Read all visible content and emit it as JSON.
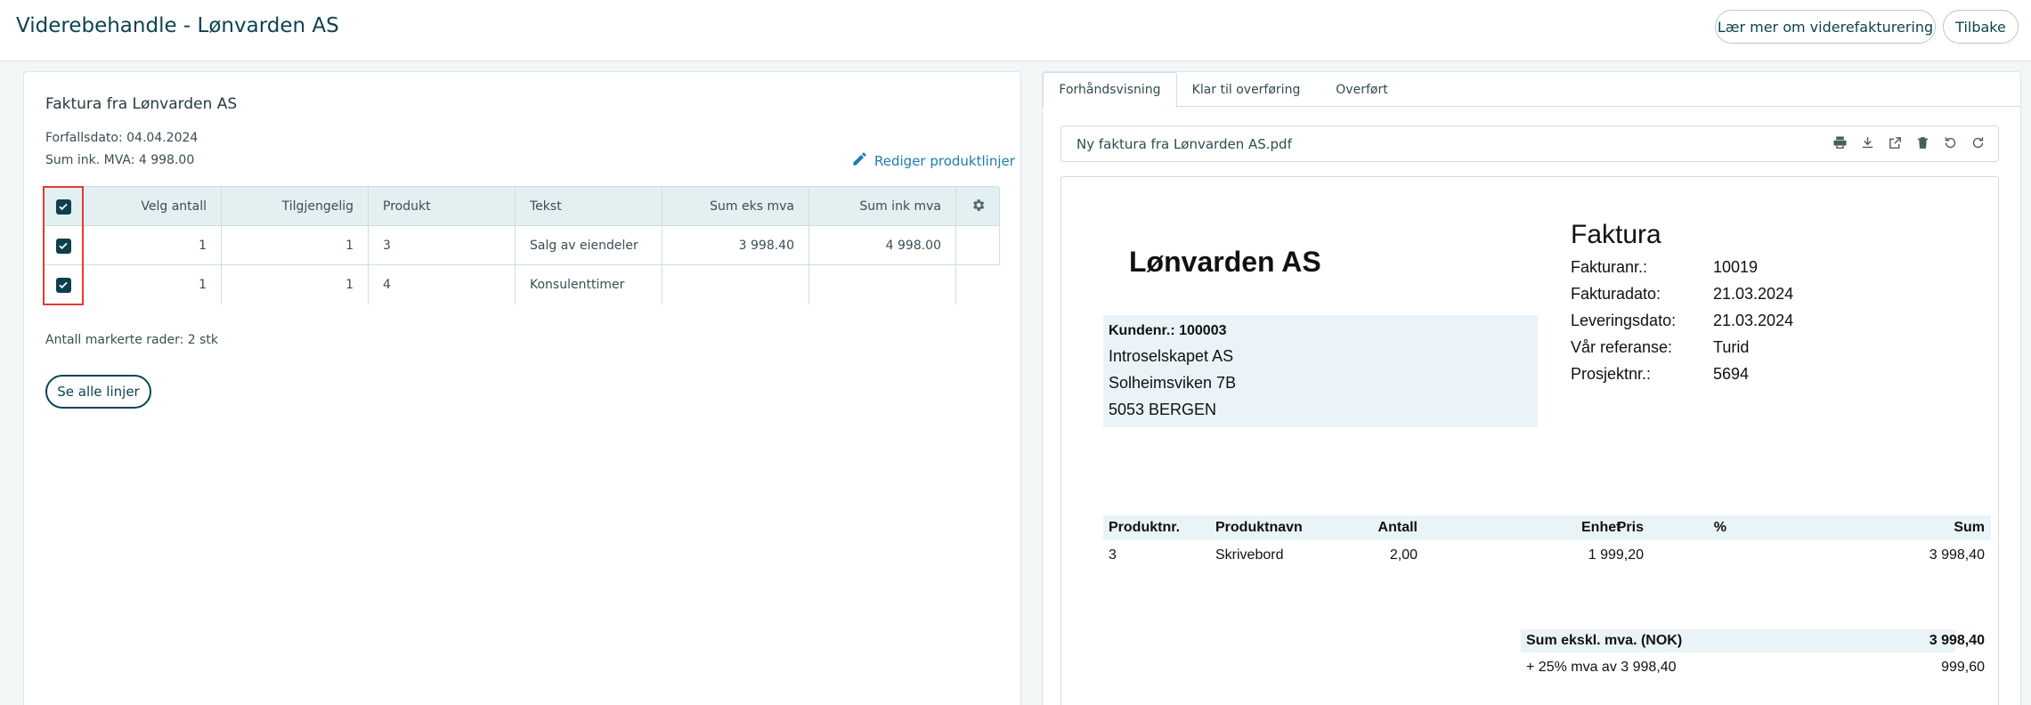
{
  "header": {
    "title": "Viderebehandle - Lønvarden AS",
    "learn_more_label": "Lær mer om viderefakturering",
    "back_label": "Tilbake"
  },
  "left": {
    "invoice_title": "Faktura fra Lønvarden AS",
    "due_date": "Forfallsdato: 04.04.2024",
    "sum_inc_vat": "Sum ink. MVA: 4 998.00",
    "edit_lines_label": "Rediger produktlinjer",
    "table": {
      "columns": [
        "Velg antall",
        "Tilgjengelig",
        "Produkt",
        "Tekst",
        "Sum eks mva",
        "Sum ink mva"
      ],
      "rows": [
        {
          "checked": true,
          "velg_antall": "1",
          "tilgjengelig": "1",
          "produkt": "3",
          "tekst": "Salg av eiendeler",
          "sum_eks": "3 998.40",
          "sum_ink": "4 998.00"
        },
        {
          "checked": true,
          "velg_antall": "1",
          "tilgjengelig": "1",
          "produkt": "4",
          "tekst": "Konsulenttimer",
          "sum_eks": "",
          "sum_ink": ""
        }
      ]
    },
    "selected_count": "Antall markerte rader: 2 stk",
    "see_all_label": "Se alle linjer"
  },
  "right": {
    "tabs": [
      {
        "label": "Forhåndsvisning",
        "active": true
      },
      {
        "label": "Klar til overføring",
        "active": false
      },
      {
        "label": "Overført",
        "active": false
      }
    ],
    "file_name": "Ny faktura fra Lønvarden AS.pdf",
    "file_icons": [
      "print-icon",
      "download-icon",
      "open-external-icon",
      "delete-icon",
      "rotate-left-icon",
      "rotate-right-icon"
    ],
    "pdf": {
      "company": "Lønvarden AS",
      "doc_title": "Faktura",
      "meta": [
        {
          "label": "Fakturanr.:",
          "value": "10019"
        },
        {
          "label": "Fakturadato:",
          "value": "21.03.2024"
        },
        {
          "label": "Leveringsdato:",
          "value": "21.03.2024"
        },
        {
          "label": "Vår referanse:",
          "value": "Turid"
        },
        {
          "label": "Prosjektnr.:",
          "value": "5694"
        }
      ],
      "customer_no": "Kundenr.: 100003",
      "customer_name": "Introselskapet AS",
      "customer_street": "Solheimsviken 7B",
      "customer_city": "5053  BERGEN",
      "lines_header": {
        "produktnr": "Produktnr.",
        "produktnavn": "Produktnavn",
        "antall": "Antall",
        "enhet": "Enhet",
        "pris": "Pris",
        "pct": "%",
        "sum": "Sum"
      },
      "lines": [
        {
          "produktnr": "3",
          "produktnavn": "Skrivebord",
          "antall": "2,00",
          "enhet": "",
          "pris": "1 999,20",
          "pct": "",
          "sum": "3 998,40"
        }
      ],
      "sum_excl_label": "Sum ekskl. mva. (NOK)",
      "sum_excl_value": "3 998,40",
      "vat_label": "+ 25% mva av 3 998,40",
      "vat_value": "999,60"
    }
  },
  "colors": {
    "primary": "#0d4350",
    "link": "#1a7fb0",
    "table_header": "#e3f0f2",
    "highlight": "#e53935",
    "pdf_band": "#eaf3f7"
  }
}
